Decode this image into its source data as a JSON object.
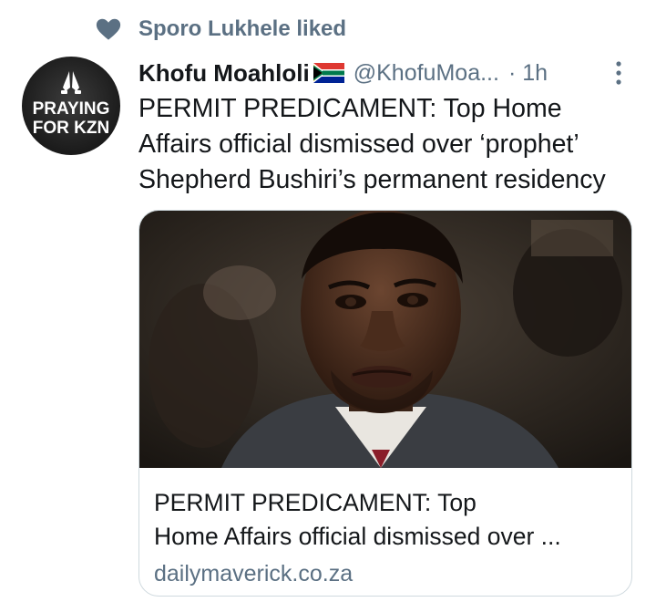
{
  "social_context": {
    "text": "Sporo Lukhele liked",
    "icon": "heart-icon"
  },
  "author": {
    "name": "Khofu Moahloli",
    "flag": "south-africa-flag-icon",
    "handle": "@KhofuMoa...",
    "time": "· 1h",
    "avatar_text_line1": "PRAYING",
    "avatar_text_line2": "FOR KZN"
  },
  "tweet": {
    "line1": "PERMIT PREDICAMENT: Top Home",
    "line2": "Affairs official dismissed over ‘prophet’",
    "line3": "Shepherd Bushiri’s permanent residency"
  },
  "card": {
    "title_line1": "PERMIT PREDICAMENT: Top",
    "title_line2": "Home Affairs official dismissed over ...",
    "domain": "dailymaverick.co.za"
  },
  "colors": {
    "secondary_text": "#5b7083",
    "primary_text": "#14171a",
    "card_border": "#cfd9de"
  }
}
